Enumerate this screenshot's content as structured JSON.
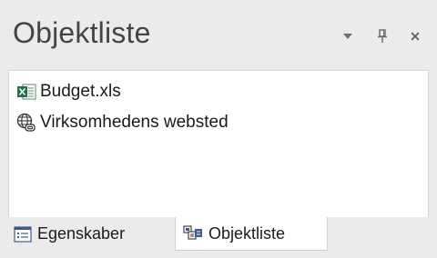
{
  "panel": {
    "title": "Objektliste"
  },
  "titlebar_buttons": {
    "dropdown_icon": "chevron-down-icon",
    "pin_icon": "pin-icon",
    "close_icon": "close-icon"
  },
  "list": {
    "items": [
      {
        "label": "Budget.xls",
        "icon": "excel-file-icon"
      },
      {
        "label": "Virksomhedens websted",
        "icon": "web-link-icon"
      }
    ]
  },
  "tabs": [
    {
      "label": "Egenskaber",
      "icon": "properties-icon",
      "selected": false
    },
    {
      "label": "Objektliste",
      "icon": "object-list-icon",
      "selected": true
    }
  ],
  "colors": {
    "background": "#ebebeb",
    "list_background": "#ffffff",
    "title_text": "#444444",
    "excel_green": "#1e7145"
  }
}
